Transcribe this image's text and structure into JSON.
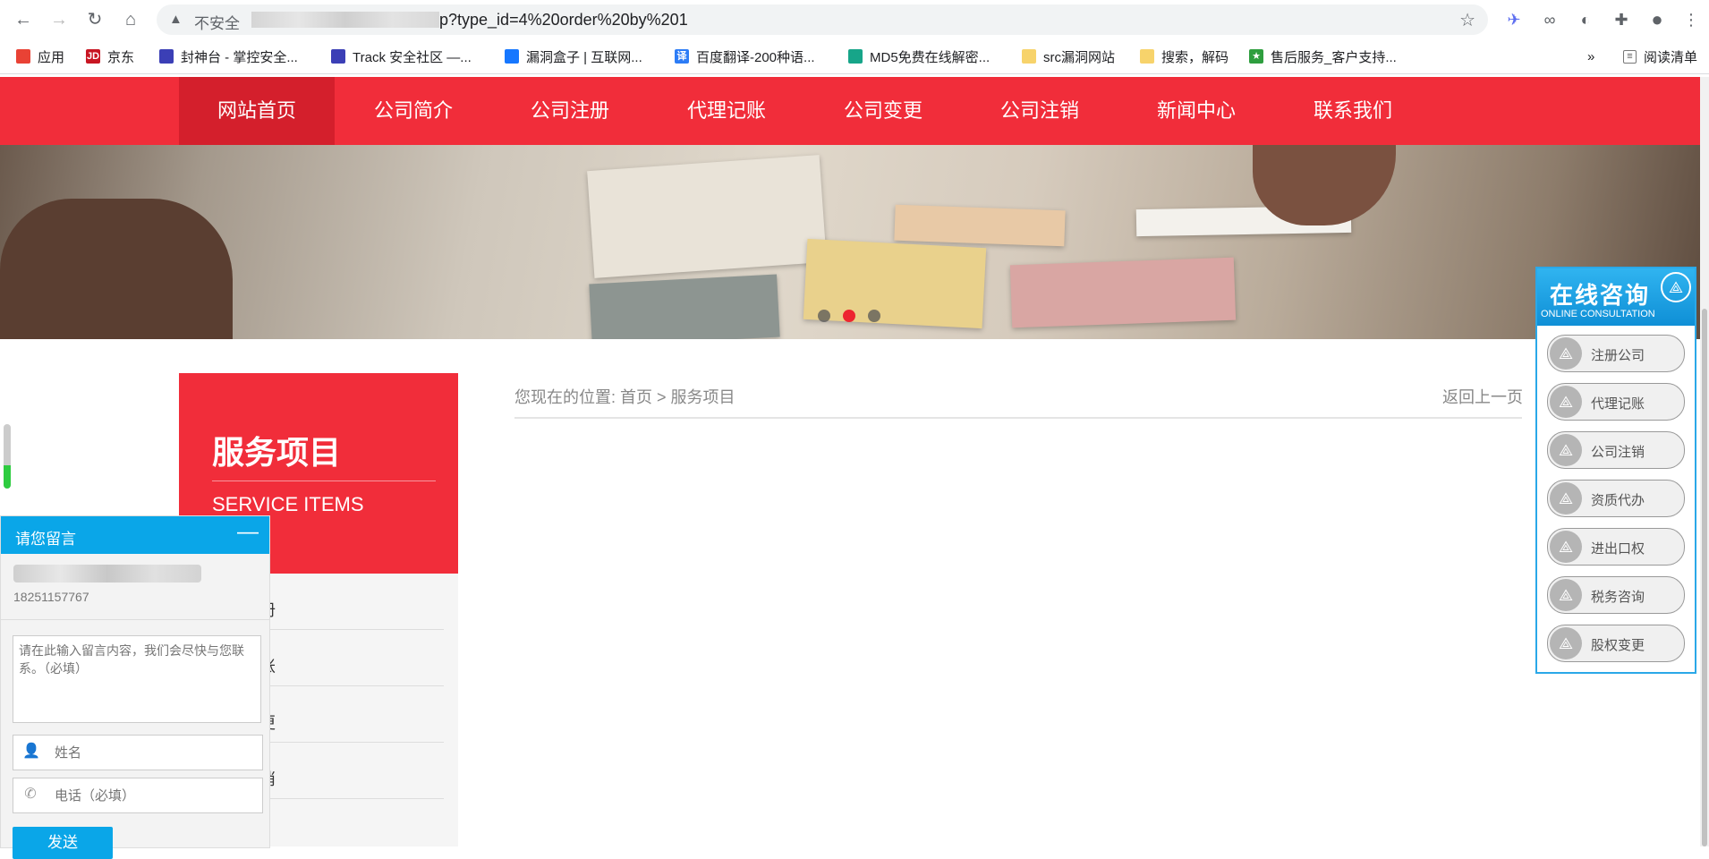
{
  "browser": {
    "insecure_label": "不安全",
    "url": "p?type_id=4%20order%20by%201",
    "bookmarks": [
      {
        "label": "应用",
        "color": "#e94235"
      },
      {
        "label": "京东",
        "color": "#c81623"
      },
      {
        "label": "封神台 - 掌控安全...",
        "color": "#3b3fb6"
      },
      {
        "label": "Track 安全社区 —...",
        "color": "#3b3fb6"
      },
      {
        "label": "漏洞盒子 | 互联网...",
        "color": "#1677ff"
      },
      {
        "label": "百度翻译-200种语...",
        "color": "#2c7cf6"
      },
      {
        "label": "MD5免费在线解密...",
        "color": "#17a589"
      },
      {
        "label": "src漏洞网站",
        "color": "#f7d36b"
      },
      {
        "label": "搜索，解码",
        "color": "#f7d36b"
      },
      {
        "label": "售后服务_客户支持...",
        "color": "#2e9e3e"
      }
    ],
    "more_label": "»",
    "reading_list": "阅读清单"
  },
  "nav": {
    "items": [
      "网站首页",
      "公司简介",
      "公司注册",
      "代理记账",
      "公司变更",
      "公司注销",
      "新闻中心",
      "联系我们"
    ],
    "active_index": 0
  },
  "banner": {
    "slide_count": 3,
    "active_slide": 1
  },
  "sidebar": {
    "title": "服务项目",
    "subtitle": "SERVICE ITEMS",
    "items": [
      "册",
      "账",
      "更",
      "消"
    ]
  },
  "content": {
    "breadcrumb": "您现在的位置: 首页 > 服务项目",
    "back_label": "返回上一页"
  },
  "message_panel": {
    "title": "请您留言",
    "minimize": "—",
    "phone": "18251157767",
    "textarea_placeholder": "请在此输入留言内容，我们会尽快与您联系。（必填）",
    "name_placeholder": "姓名",
    "phone_placeholder": "电话（必填）",
    "send_label": "发送"
  },
  "online_consult": {
    "title": "在线咨询",
    "subtitle": "ONLINE CONSULTATION",
    "items": [
      "注册公司",
      "代理记账",
      "公司注销",
      "资质代办",
      "进出口权",
      "税务咨询",
      "股权变更"
    ]
  }
}
